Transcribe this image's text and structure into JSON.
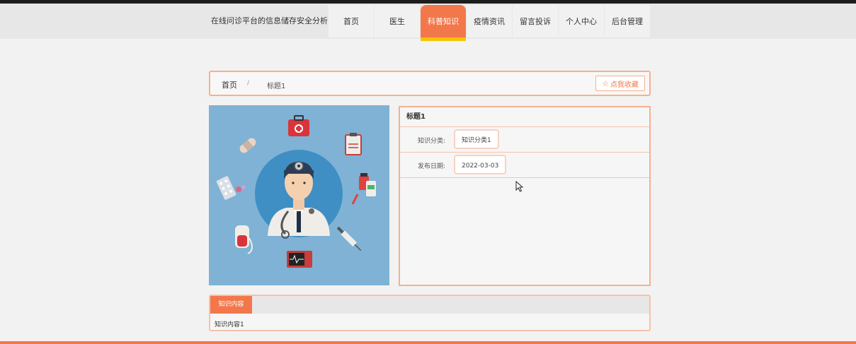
{
  "site": {
    "title": "在线问诊平台的信息储存安全分析"
  },
  "nav": {
    "items": [
      {
        "label": "首页"
      },
      {
        "label": "医生"
      },
      {
        "label": "科普知识"
      },
      {
        "label": "疫情资讯"
      },
      {
        "label": "留言投诉"
      },
      {
        "label": "个人中心"
      },
      {
        "label": "后台管理"
      }
    ],
    "active": "科普知识"
  },
  "breadcrumb": {
    "home": "首页",
    "separator": "/",
    "current": "标题1"
  },
  "favorite": {
    "icon": "star-icon",
    "label": "点我收藏"
  },
  "detail": {
    "title": "标题1",
    "category_label": "知识分类:",
    "category_value": "知识分类1",
    "date_label": "发布日期:",
    "date_value": "2022-03-03"
  },
  "content": {
    "tab_label": "知识内容",
    "text": "知识内容1"
  },
  "colors": {
    "accent": "#f2784b",
    "accent_border": "#f3b18f",
    "highlight": "#f7c300",
    "image_bg": "#7fb2d4"
  },
  "image": {
    "icon": "doctor-illustration"
  }
}
